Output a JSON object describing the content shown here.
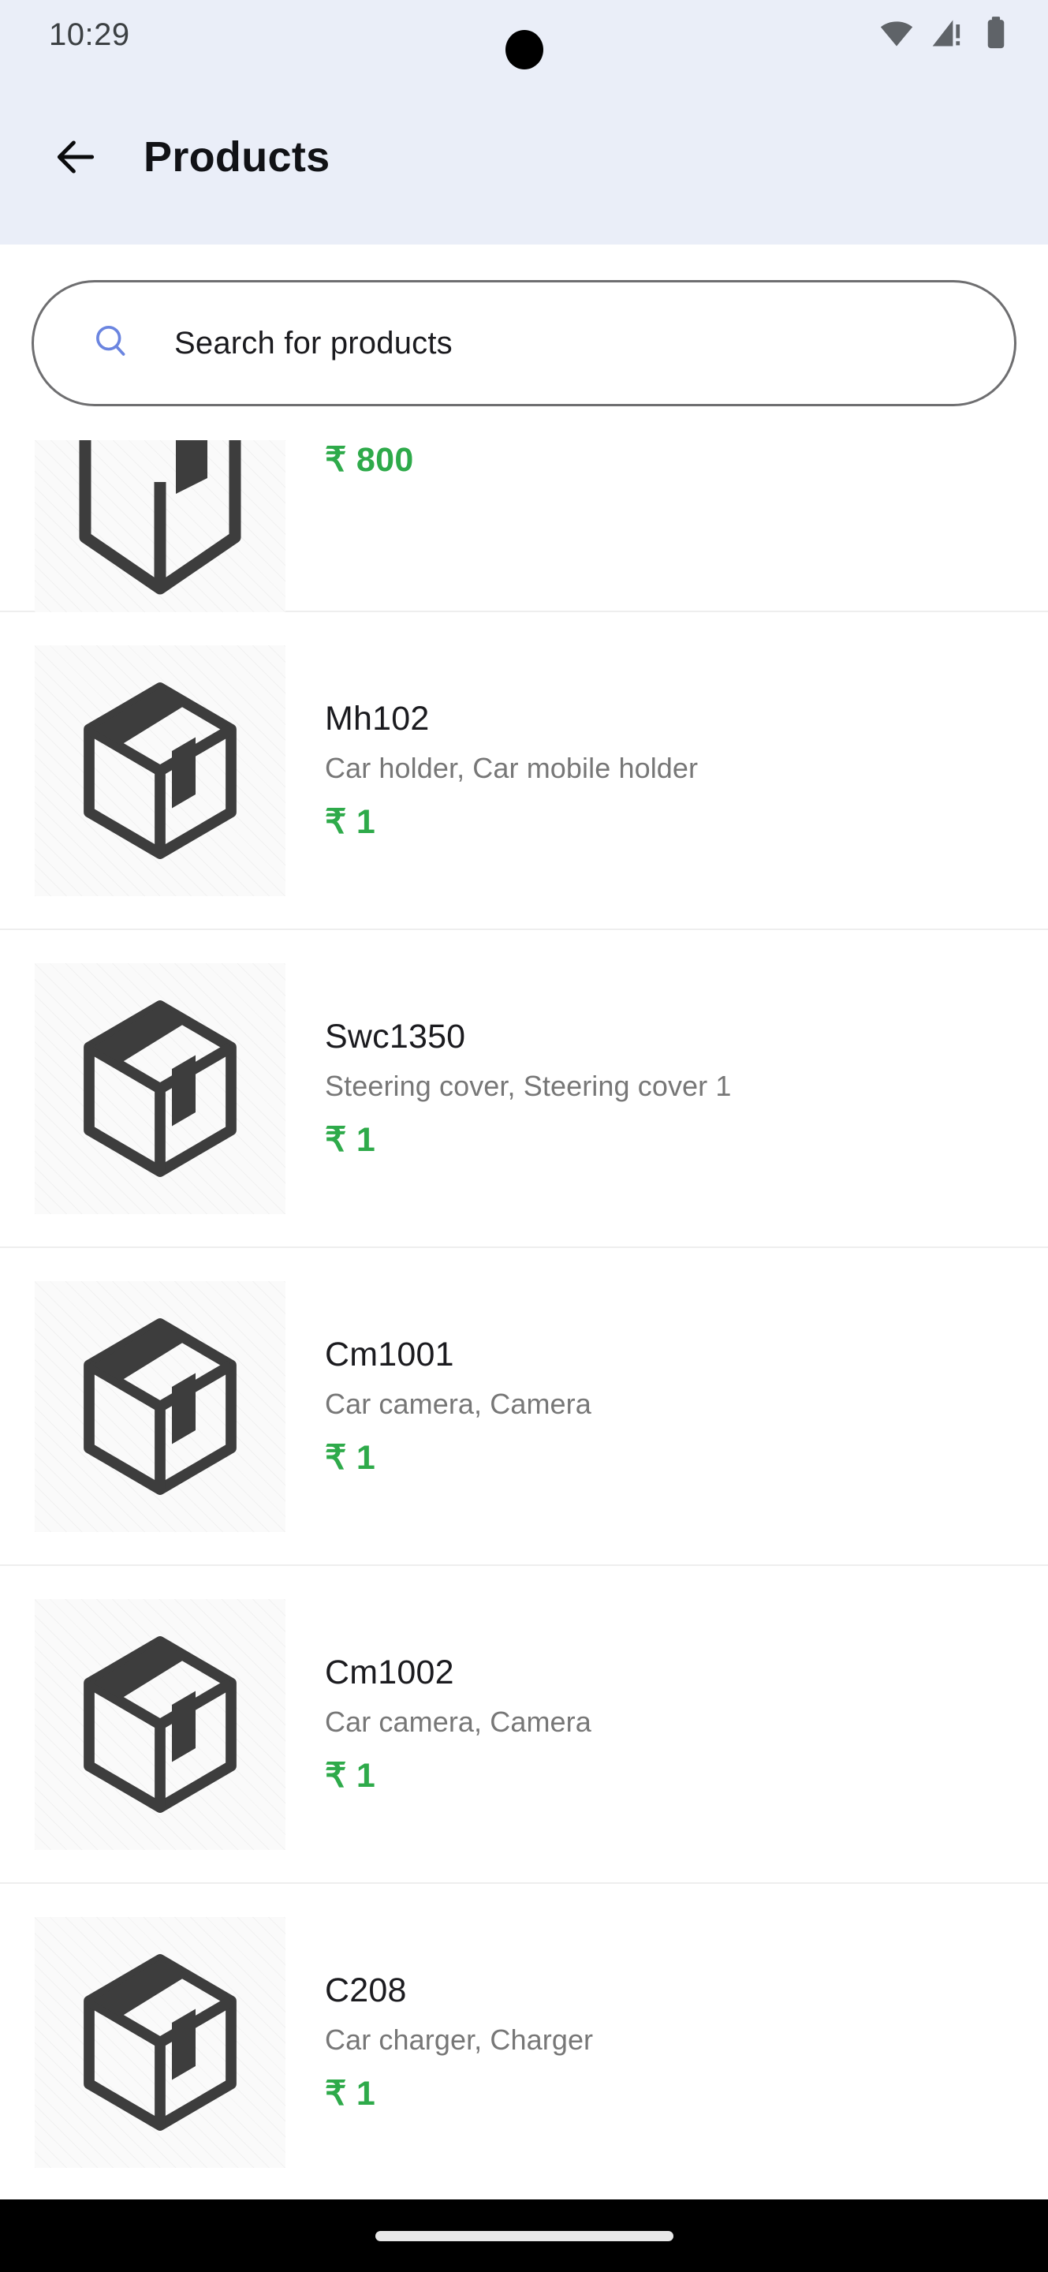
{
  "status_bar": {
    "time": "10:29",
    "icons": [
      "wifi-icon",
      "cellular-signal-icon",
      "battery-icon"
    ]
  },
  "app_bar": {
    "back_icon": "arrow-left-icon",
    "title": "Products",
    "background_color": "#eaeef8"
  },
  "search": {
    "icon": "search-icon",
    "placeholder": "Search for products",
    "value": "",
    "icon_color": "#6b85e0"
  },
  "colors": {
    "price_green": "#2eaa4a",
    "name_text": "#1b1b1f",
    "category_text": "#777777",
    "divider": "#eeeeee",
    "thumb_bg": "#fafafa",
    "box_stroke": "#3d3d3d"
  },
  "products": [
    {
      "name": "",
      "categories": "",
      "price": "₹ 800",
      "thumbnail": "box-placeholder-icon",
      "partial": true
    },
    {
      "name": "Mh102",
      "categories": "Car holder,  Car mobile holder",
      "price": "₹ 1",
      "thumbnail": "box-placeholder-icon",
      "partial": false
    },
    {
      "name": "Swc1350",
      "categories": "Steering cover,  Steering cover 1",
      "price": "₹ 1",
      "thumbnail": "box-placeholder-icon",
      "partial": false
    },
    {
      "name": "Cm1001",
      "categories": "Car camera,  Camera",
      "price": "₹ 1",
      "thumbnail": "box-placeholder-icon",
      "partial": false
    },
    {
      "name": "Cm1002",
      "categories": "Car camera,  Camera",
      "price": "₹ 1",
      "thumbnail": "box-placeholder-icon",
      "partial": false
    },
    {
      "name": "C208",
      "categories": "Car charger,  Charger",
      "price": "₹ 1",
      "thumbnail": "box-placeholder-icon",
      "partial": false
    }
  ],
  "nav_bar": {
    "home_indicator": "home-indicator-pill"
  }
}
